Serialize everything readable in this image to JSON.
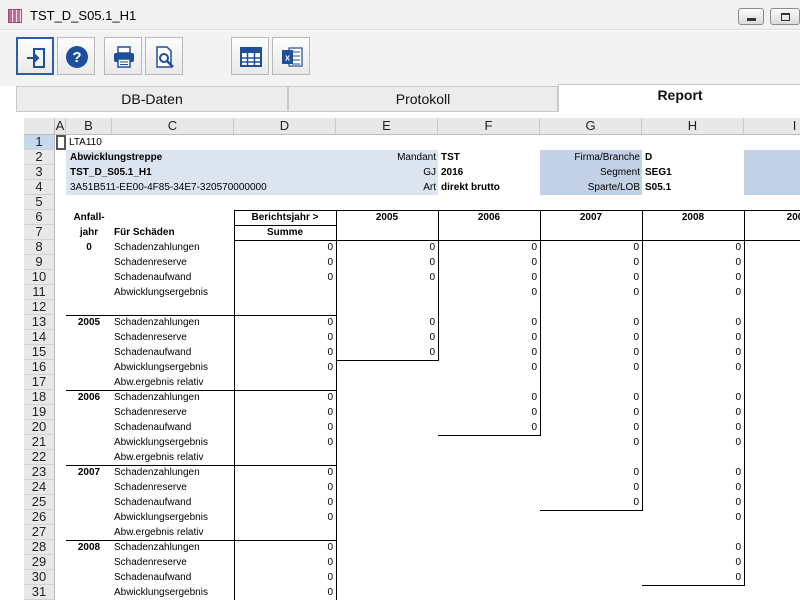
{
  "window": {
    "title": "TST_D_S05.1_H1"
  },
  "toolbar": {
    "buttons": [
      {
        "name": "exit-icon",
        "label": "Exit"
      },
      {
        "name": "help-icon",
        "label": "Help"
      },
      {
        "name": "print-icon",
        "label": "Print"
      },
      {
        "name": "print-preview-icon",
        "label": "Print preview"
      },
      {
        "name": "table-icon",
        "label": "Table"
      },
      {
        "name": "excel-icon",
        "label": "Excel export"
      }
    ]
  },
  "tabs": [
    {
      "label": "DB-Daten"
    },
    {
      "label": "Protokoll"
    },
    {
      "label": "Report",
      "active": true
    }
  ],
  "sheet": {
    "columns": [
      "A",
      "B",
      "C",
      "D",
      "E",
      "F",
      "G",
      "H",
      "I"
    ],
    "rows": [
      "1",
      "2",
      "3",
      "4",
      "5",
      "6",
      "7",
      "8",
      "9",
      "10",
      "11",
      "12",
      "13",
      "14",
      "15",
      "16",
      "17",
      "18",
      "19",
      "20",
      "21",
      "22",
      "23",
      "24",
      "25",
      "26",
      "27",
      "28",
      "29",
      "30",
      "31"
    ],
    "selected_row": "1",
    "cell_a1": "LTA110",
    "header": {
      "title": "Abwicklungstreppe",
      "report_id": "TST_D_S05.1_H1",
      "guid": "3A51B511-EE00-4F85-34E7-320570000000",
      "mandant_label": "Mandant",
      "mandant_value": "TST",
      "gj_label": "GJ",
      "gj_value": "2016",
      "art_label": "Art",
      "art_value": "direkt brutto",
      "firma_label": "Firma/Branche",
      "firma_value": "D",
      "segment_label": "Segment",
      "segment_value": "SEG1",
      "sparte_label": "Sparte/LOB",
      "sparte_value": "S05.1"
    },
    "table_header": {
      "anfall": "Anfall-",
      "jahr": "jahr",
      "fuer_schaeden": "Für Schäden",
      "berichtsjahr": "Berichtsjahr >",
      "summe": "Summe",
      "years": [
        "2005",
        "2006",
        "2007",
        "2008",
        "200"
      ]
    },
    "groups": [
      {
        "year": "0",
        "lines": [
          {
            "label": "Schadenzahlungen",
            "summe": "0",
            "values": [
              "0",
              "0",
              "0",
              "0"
            ]
          },
          {
            "label": "Schadenreserve",
            "summe": "0",
            "values": [
              "0",
              "0",
              "0",
              "0"
            ]
          },
          {
            "label": "Schadenaufwand",
            "summe": "0",
            "values": [
              "0",
              "0",
              "0",
              "0"
            ]
          },
          {
            "label": "Abwicklungsergebnis",
            "summe": "",
            "values": [
              "",
              "0",
              "0",
              "0"
            ]
          }
        ]
      },
      {
        "year": "2005",
        "lines": [
          {
            "label": "Schadenzahlungen",
            "summe": "0",
            "values": [
              "0",
              "0",
              "0",
              "0"
            ]
          },
          {
            "label": "Schadenreserve",
            "summe": "0",
            "values": [
              "0",
              "0",
              "0",
              "0"
            ]
          },
          {
            "label": "Schadenaufwand",
            "summe": "0",
            "values": [
              "0",
              "0",
              "0",
              "0"
            ]
          },
          {
            "label": "Abwicklungsergebnis",
            "summe": "0",
            "values": [
              "",
              "0",
              "0",
              "0"
            ]
          },
          {
            "label": "Abw.ergebnis relativ",
            "summe": "",
            "values": [
              "",
              "",
              "",
              ""
            ]
          }
        ]
      },
      {
        "year": "2006",
        "lines": [
          {
            "label": "Schadenzahlungen",
            "summe": "0",
            "values": [
              "",
              "0",
              "0",
              "0"
            ]
          },
          {
            "label": "Schadenreserve",
            "summe": "0",
            "values": [
              "",
              "0",
              "0",
              "0"
            ]
          },
          {
            "label": "Schadenaufwand",
            "summe": "0",
            "values": [
              "",
              "0",
              "0",
              "0"
            ]
          },
          {
            "label": "Abwicklungsergebnis",
            "summe": "0",
            "values": [
              "",
              "",
              "0",
              "0"
            ]
          },
          {
            "label": "Abw.ergebnis relativ",
            "summe": "",
            "values": [
              "",
              "",
              "",
              ""
            ]
          }
        ]
      },
      {
        "year": "2007",
        "lines": [
          {
            "label": "Schadenzahlungen",
            "summe": "0",
            "values": [
              "",
              "",
              "0",
              "0"
            ]
          },
          {
            "label": "Schadenreserve",
            "summe": "0",
            "values": [
              "",
              "",
              "0",
              "0"
            ]
          },
          {
            "label": "Schadenaufwand",
            "summe": "0",
            "values": [
              "",
              "",
              "0",
              "0"
            ]
          },
          {
            "label": "Abwicklungsergebnis",
            "summe": "0",
            "values": [
              "",
              "",
              "",
              "0"
            ]
          },
          {
            "label": "Abw.ergebnis relativ",
            "summe": "",
            "values": [
              "",
              "",
              "",
              ""
            ]
          }
        ]
      },
      {
        "year": "2008",
        "lines": [
          {
            "label": "Schadenzahlungen",
            "summe": "0",
            "values": [
              "",
              "",
              "",
              "0"
            ]
          },
          {
            "label": "Schadenreserve",
            "summe": "0",
            "values": [
              "",
              "",
              "",
              "0"
            ]
          },
          {
            "label": "Schadenaufwand",
            "summe": "0",
            "values": [
              "",
              "",
              "",
              "0"
            ]
          },
          {
            "label": "Abwicklungsergebnis",
            "summe": "0",
            "values": [
              "",
              "",
              "",
              ""
            ]
          }
        ]
      }
    ]
  }
}
